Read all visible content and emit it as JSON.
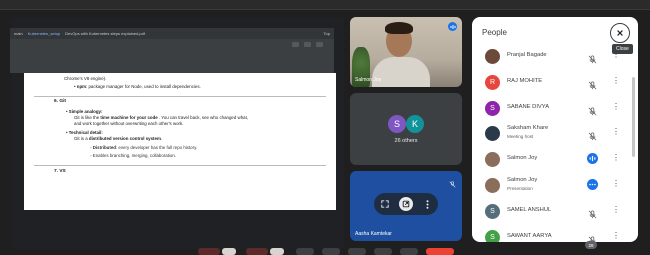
{
  "presentation": {
    "toolbar": {
      "branch": "main",
      "breadcrumb": "Kubernetes_setup",
      "filename": "DevOps with Kubernetes steps explained.pdf",
      "zoom": "Top"
    },
    "pdf": {
      "line1": "Chrome's V8 engine).",
      "npm_label": "npm",
      "npm_text": ": package manager for Node, used to install dependencies.",
      "section_title": "6. Git",
      "simple_label": "Simple analogy:",
      "simple_line1_pre": "Git is like the ",
      "simple_line1_bold": "time machine for your code",
      "simple_line1_post": " . You can travel back, see who changed what,",
      "simple_line2": "and work together without overwriting each other's work.",
      "tech_label": "Technical detail:",
      "tech_pre": "Git is a ",
      "tech_bold": "distributed version control system",
      "tech_post": ".",
      "dist_bold": "Distributed",
      "dist_text": ": every developer has the full repo history.",
      "branch_text": "Enables branching, merging, collaboration.",
      "next_section": "7. VS"
    }
  },
  "tiles": {
    "camera_name": "Salmon Joy",
    "others_label": "26 others",
    "others_avatars": [
      {
        "letter": "S",
        "color": "#7e57c2"
      },
      {
        "letter": "K",
        "color": "#12939a"
      }
    ],
    "aasha_name": "Aasha Kamtekar"
  },
  "people_panel": {
    "title": "People",
    "close_tooltip": "Close",
    "people": [
      {
        "name": "Pranjal Bagade",
        "sub": "",
        "avatar_letter": "",
        "avatar_color": "#6b4a3a",
        "status": "mic-off"
      },
      {
        "name": "RAJ MOHITE",
        "sub": "",
        "avatar_letter": "R",
        "avatar_color": "#e8453c",
        "status": "mic-off"
      },
      {
        "name": "SABANE DIVYA",
        "sub": "",
        "avatar_letter": "S",
        "avatar_color": "#8e24aa",
        "status": "mic-off"
      },
      {
        "name": "Saksham Khare",
        "sub": "Meeting host",
        "avatar_letter": "",
        "avatar_color": "#2b3a4a",
        "status": "mic-off"
      },
      {
        "name": "Salmon Joy",
        "sub": "",
        "avatar_letter": "",
        "avatar_color": "#8a6d5a",
        "status": "speaking"
      },
      {
        "name": "Salmon Joy",
        "sub": "Presentation",
        "avatar_letter": "",
        "avatar_color": "#8a6d5a",
        "status": "presenting"
      },
      {
        "name": "SAMEL ANSHUL",
        "sub": "",
        "avatar_letter": "S",
        "avatar_color": "#546e7a",
        "status": "mic-off"
      },
      {
        "name": "SAWANT AARYA",
        "sub": "",
        "avatar_letter": "S",
        "avatar_color": "#43a047",
        "status": "mic-off"
      }
    ]
  },
  "bottom": {
    "participant_count": "28"
  },
  "colors": {
    "accent": "#1a73e8",
    "end_call": "#ea4335"
  }
}
